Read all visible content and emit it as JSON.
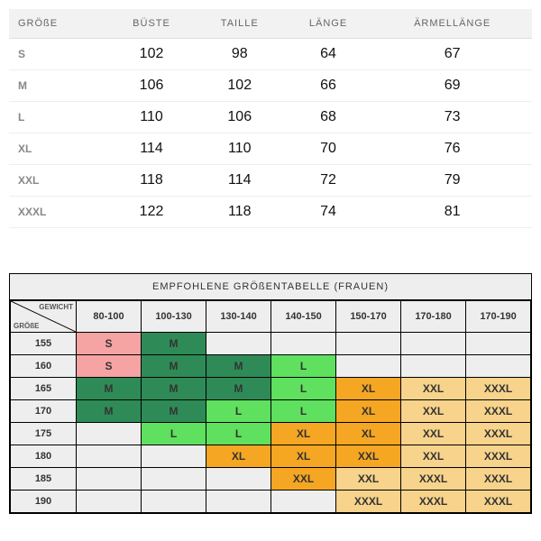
{
  "table1": {
    "headers": [
      "GRÖßE",
      "BÜSTE",
      "TAILLE",
      "LÄNGE",
      "ÄRMELLÄNGE"
    ],
    "rows": [
      {
        "size": "S",
        "bust": "102",
        "waist": "98",
        "length": "64",
        "sleeve": "67"
      },
      {
        "size": "M",
        "bust": "106",
        "waist": "102",
        "length": "66",
        "sleeve": "69"
      },
      {
        "size": "L",
        "bust": "110",
        "waist": "106",
        "length": "68",
        "sleeve": "73"
      },
      {
        "size": "XL",
        "bust": "114",
        "waist": "110",
        "length": "70",
        "sleeve": "76"
      },
      {
        "size": "XXL",
        "bust": "118",
        "waist": "114",
        "length": "72",
        "sleeve": "79"
      },
      {
        "size": "XXXL",
        "bust": "122",
        "waist": "118",
        "length": "74",
        "sleeve": "81"
      }
    ]
  },
  "table2": {
    "title": "EMPFOHLENE GRÖßENTABELLE (FRAUEN)",
    "corner": {
      "weight_label": "GEWICHT",
      "size_label": "GRÖßE"
    },
    "col_headers": [
      "80-100",
      "100-130",
      "130-140",
      "140-150",
      "150-170",
      "170-180",
      "170-190"
    ],
    "row_headers": [
      "155",
      "160",
      "165",
      "170",
      "175",
      "180",
      "185",
      "190"
    ],
    "cells": [
      [
        {
          "v": "S",
          "c": "c-pink"
        },
        {
          "v": "M",
          "c": "c-dgreen"
        },
        {
          "v": "",
          "c": ""
        },
        {
          "v": "",
          "c": ""
        },
        {
          "v": "",
          "c": ""
        },
        {
          "v": "",
          "c": ""
        },
        {
          "v": "",
          "c": ""
        }
      ],
      [
        {
          "v": "S",
          "c": "c-pink"
        },
        {
          "v": "M",
          "c": "c-dgreen"
        },
        {
          "v": "M",
          "c": "c-dgreen"
        },
        {
          "v": "L",
          "c": "c-lgreen"
        },
        {
          "v": "",
          "c": ""
        },
        {
          "v": "",
          "c": ""
        },
        {
          "v": "",
          "c": ""
        }
      ],
      [
        {
          "v": "M",
          "c": "c-dgreen"
        },
        {
          "v": "M",
          "c": "c-dgreen"
        },
        {
          "v": "M",
          "c": "c-dgreen"
        },
        {
          "v": "L",
          "c": "c-lgreen"
        },
        {
          "v": "XL",
          "c": "c-orange"
        },
        {
          "v": "XXL",
          "c": "c-lorange"
        },
        {
          "v": "XXXL",
          "c": "c-lorange"
        }
      ],
      [
        {
          "v": "M",
          "c": "c-dgreen"
        },
        {
          "v": "M",
          "c": "c-dgreen"
        },
        {
          "v": "L",
          "c": "c-lgreen"
        },
        {
          "v": "L",
          "c": "c-lgreen"
        },
        {
          "v": "XL",
          "c": "c-orange"
        },
        {
          "v": "XXL",
          "c": "c-lorange"
        },
        {
          "v": "XXXL",
          "c": "c-lorange"
        }
      ],
      [
        {
          "v": "",
          "c": ""
        },
        {
          "v": "L",
          "c": "c-lgreen"
        },
        {
          "v": "L",
          "c": "c-lgreen"
        },
        {
          "v": "XL",
          "c": "c-orange"
        },
        {
          "v": "XL",
          "c": "c-orange"
        },
        {
          "v": "XXL",
          "c": "c-lorange"
        },
        {
          "v": "XXXL",
          "c": "c-lorange"
        }
      ],
      [
        {
          "v": "",
          "c": ""
        },
        {
          "v": "",
          "c": ""
        },
        {
          "v": "XL",
          "c": "c-orange"
        },
        {
          "v": "XL",
          "c": "c-orange"
        },
        {
          "v": "XXL",
          "c": "c-orange"
        },
        {
          "v": "XXL",
          "c": "c-lorange"
        },
        {
          "v": "XXXL",
          "c": "c-lorange"
        }
      ],
      [
        {
          "v": "",
          "c": ""
        },
        {
          "v": "",
          "c": ""
        },
        {
          "v": "",
          "c": ""
        },
        {
          "v": "XXL",
          "c": "c-orange"
        },
        {
          "v": "XXL",
          "c": "c-lorange"
        },
        {
          "v": "XXXL",
          "c": "c-lorange"
        },
        {
          "v": "XXXL",
          "c": "c-lorange"
        }
      ],
      [
        {
          "v": "",
          "c": ""
        },
        {
          "v": "",
          "c": ""
        },
        {
          "v": "",
          "c": ""
        },
        {
          "v": "",
          "c": ""
        },
        {
          "v": "XXXL",
          "c": "c-lorange"
        },
        {
          "v": "XXXL",
          "c": "c-lorange"
        },
        {
          "v": "XXXL",
          "c": "c-lorange"
        }
      ]
    ]
  }
}
